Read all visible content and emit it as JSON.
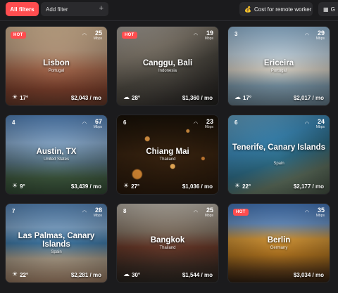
{
  "toolbar": {
    "all_filters_label": "All filters",
    "add_filter_label": "Add filter",
    "add_filter_icon": "+",
    "cost_filter_label": "Cost for remote worker",
    "cost_filter_icon": "money-bag-icon",
    "partial_filter_label": "G"
  },
  "cards": [
    {
      "name": "lisbon",
      "badge": "HOT",
      "city": "Lisbon",
      "country": "Portugal",
      "wifi": "25",
      "wifi_unit": "Mbps",
      "temp": "17°",
      "price": "$2,043 / mo",
      "weather_icon": "sun-icon"
    },
    {
      "name": "canggu",
      "badge": "HOT",
      "city": "Canggu, Bali",
      "country": "Indonesia",
      "wifi": "19",
      "wifi_unit": "Mbps",
      "temp": "28°",
      "price": "$1,360 / mo",
      "weather_icon": "cloud-icon"
    },
    {
      "name": "ericeira",
      "rank": "3",
      "city": "Ericeira",
      "country": "Portugal",
      "wifi": "29",
      "wifi_unit": "Mbps",
      "temp": "17°",
      "price": "$2,017 / mo",
      "weather_icon": "cloud-icon"
    },
    {
      "name": "austin",
      "rank": "4",
      "city": "Austin, TX",
      "country": "United States",
      "wifi": "67",
      "wifi_unit": "Mbps",
      "temp": "9°",
      "price": "$3,439 / mo",
      "weather_icon": "sun-icon"
    },
    {
      "name": "chiang-mai",
      "rank": "6",
      "city": "Chiang Mai",
      "country": "Thailand",
      "wifi": "23",
      "wifi_unit": "Mbps",
      "temp": "27°",
      "price": "$1,036 / mo",
      "weather_icon": "sun-icon"
    },
    {
      "name": "tenerife",
      "rank": "6",
      "city": "Tenerife, Canary Islands",
      "country": "Spain",
      "wifi": "24",
      "wifi_unit": "Mbps",
      "temp": "22°",
      "price": "$2,177 / mo",
      "weather_icon": "sun-icon"
    },
    {
      "name": "las-palmas",
      "rank": "7",
      "city": "Las Palmas, Canary Islands",
      "country": "Spain",
      "wifi": "28",
      "wifi_unit": "Mbps",
      "temp": "22°",
      "price": "$2,281 / mo",
      "weather_icon": "sun-icon"
    },
    {
      "name": "bangkok",
      "rank": "8",
      "city": "Bangkok",
      "country": "Thailand",
      "wifi": "25",
      "wifi_unit": "Mbps",
      "temp": "30°",
      "price": "$1,544 / mo",
      "weather_icon": "cloud-icon"
    },
    {
      "name": "berlin",
      "badge": "HOT",
      "city": "Berlin",
      "country": "Germany",
      "wifi": "35",
      "wifi_unit": "Mbps",
      "temp": "",
      "price": "$3,034 / mo",
      "weather_icon": ""
    }
  ],
  "colors": {
    "accent": "#ff4d4f",
    "background": "#1b1b1d",
    "control": "#2a2a2d"
  }
}
